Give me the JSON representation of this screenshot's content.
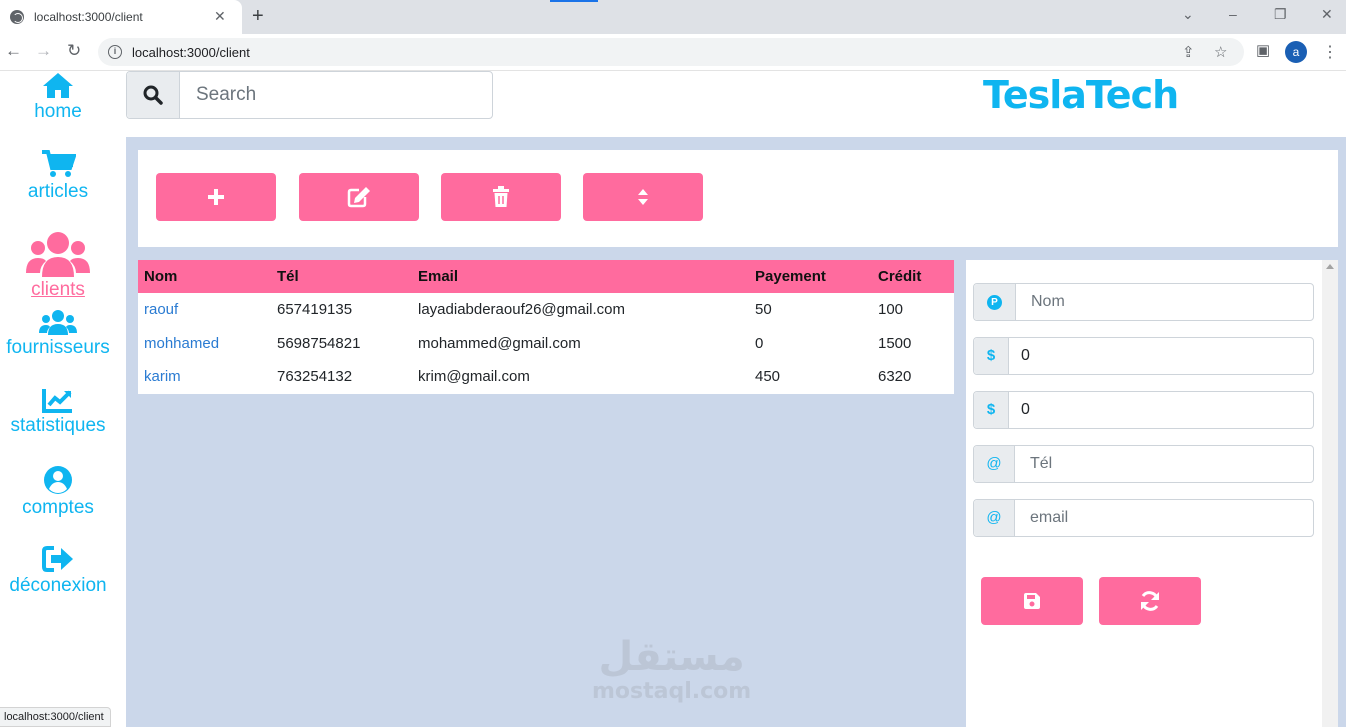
{
  "browser": {
    "tab_title": "localhost:3000/client",
    "tab_close": "✕",
    "new_tab": "+",
    "url": "localhost:3000/client",
    "minimize": "–",
    "restore": "❐",
    "close": "✕",
    "profile_initial": "a",
    "status_url": "localhost:3000/client"
  },
  "search": {
    "placeholder": "Search"
  },
  "brand": "TeslaTech",
  "sidebar": {
    "items": [
      {
        "label": "home",
        "icon": "home-icon"
      },
      {
        "label": "articles",
        "icon": "cart-icon"
      },
      {
        "label": "clients",
        "icon": "users-icon",
        "active": true
      },
      {
        "label": "fournisseurs",
        "icon": "users-icon"
      },
      {
        "label": "statistiques",
        "icon": "chart-line-icon"
      },
      {
        "label": "comptes",
        "icon": "user-circle-icon"
      },
      {
        "label": "déconexion",
        "icon": "sign-out-icon"
      }
    ]
  },
  "actions": [
    "plus-icon",
    "edit-icon",
    "trash-icon",
    "sort-icon"
  ],
  "table": {
    "headers": [
      "Nom",
      "Tél",
      "Email",
      "Payement",
      "Crédit"
    ],
    "rows": [
      [
        "raouf",
        "657419135",
        "layadiabderaouf26@gmail.com",
        "50",
        "100"
      ],
      [
        "mohhamed",
        "5698754821",
        "mohammed@gmail.com",
        "0",
        "1500"
      ],
      [
        "karim",
        "763254132",
        "krim@gmail.com",
        "450",
        "6320"
      ]
    ]
  },
  "form": {
    "nom_placeholder": "Nom",
    "nom_addon": "P",
    "payement_value": "0",
    "payement_addon": "$",
    "credit_value": "0",
    "credit_addon": "$",
    "tel_placeholder": "Tél",
    "tel_addon": "@",
    "email_placeholder": "email",
    "email_addon": "@",
    "buttons": [
      "save-icon",
      "refresh-icon"
    ]
  },
  "watermark": {
    "arabic": "مستقل",
    "latin": "mostaql.com"
  },
  "colors": {
    "accent_pink": "#ff6b9e",
    "accent_blue": "#0fb5f0",
    "main_bg": "#cbd7ea"
  }
}
